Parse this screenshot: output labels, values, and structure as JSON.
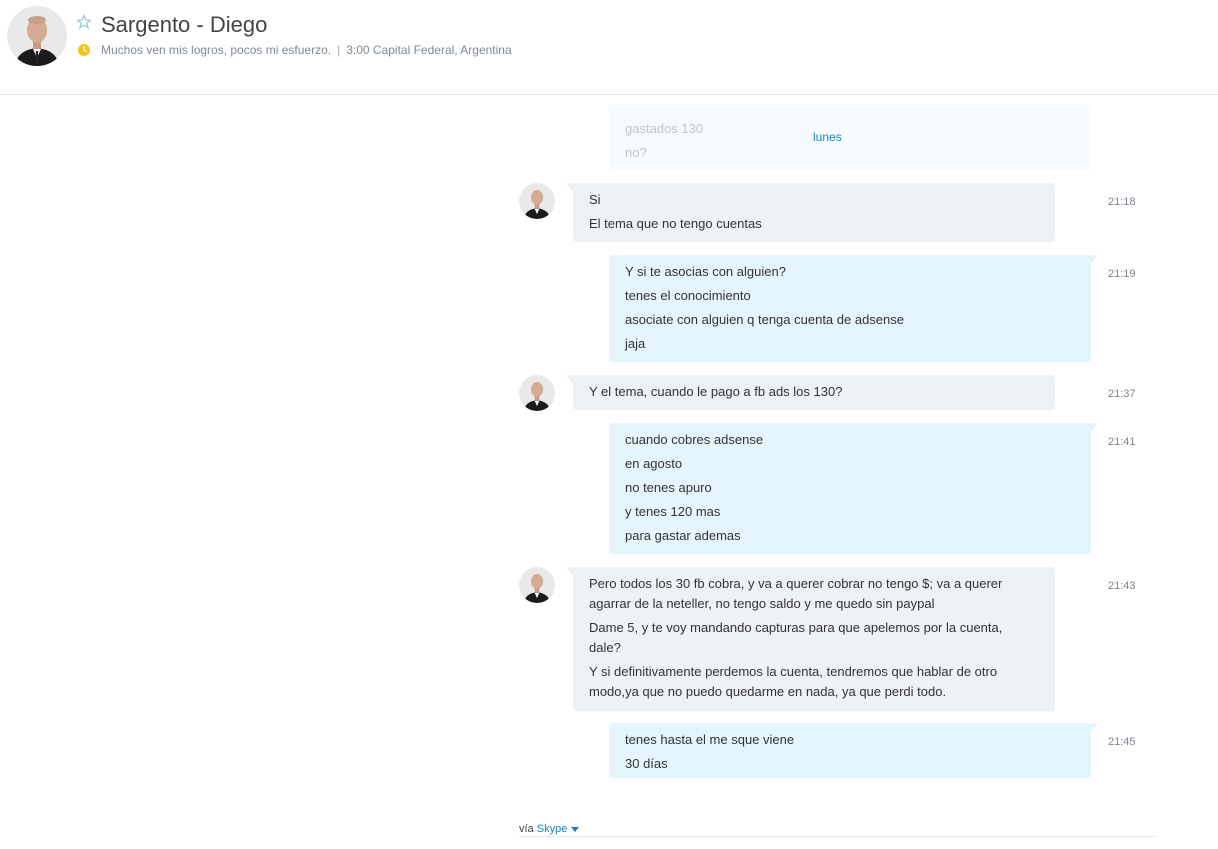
{
  "header": {
    "contact_name": "Sargento - Diego",
    "mood": "Muchos ven mis logros, pocos mi esfuerzo.",
    "separator": "|",
    "local_time": "3:00 Capital Federal, Argentina"
  },
  "conversation": {
    "faded_lines": [
      "gastados 130",
      "no?"
    ],
    "day_label": "lunes",
    "messages": [
      {
        "direction": "in",
        "time": "21:18",
        "lines": [
          "Si",
          "El tema que no tengo cuentas"
        ]
      },
      {
        "direction": "out",
        "time": "21:19",
        "lines": [
          "Y si te asocias con alguien?",
          "tenes el conocimiento",
          "asociate con alguien q tenga cuenta de adsense",
          "jaja"
        ]
      },
      {
        "direction": "in",
        "time": "21:37",
        "lines": [
          "Y el tema, cuando le pago a fb ads los 130?"
        ]
      },
      {
        "direction": "out",
        "time": "21:41",
        "lines": [
          "cuando cobres adsense",
          "en agosto",
          "no tenes apuro",
          "y tenes 120 mas",
          "para gastar ademas"
        ]
      },
      {
        "direction": "in",
        "time": "21:43",
        "lines": [
          "Pero todos los 30 fb cobra, y va a querer cobrar no tengo $; va a querer agarrar de la neteller, no tengo saldo y me quedo sin paypal",
          "Dame 5, y te voy mandando capturas para que apelemos por la cuenta, dale?",
          "Y si definitivamente perdemos la cuenta, tendremos que hablar de otro modo,ya  que no puedo quedarme en nada, ya que perdi todo."
        ]
      },
      {
        "direction": "out",
        "time": "21:45",
        "lines": [
          "tenes hasta el me sque viene",
          "30 días"
        ]
      }
    ]
  },
  "footer": {
    "via_label": "vía",
    "via_app": "Skype"
  },
  "colors": {
    "accent": "#1a7fc0",
    "incoming_bubble": "#eef1f5",
    "outgoing_bubble": "#e4f5fd",
    "status_away": "#f5c518"
  }
}
